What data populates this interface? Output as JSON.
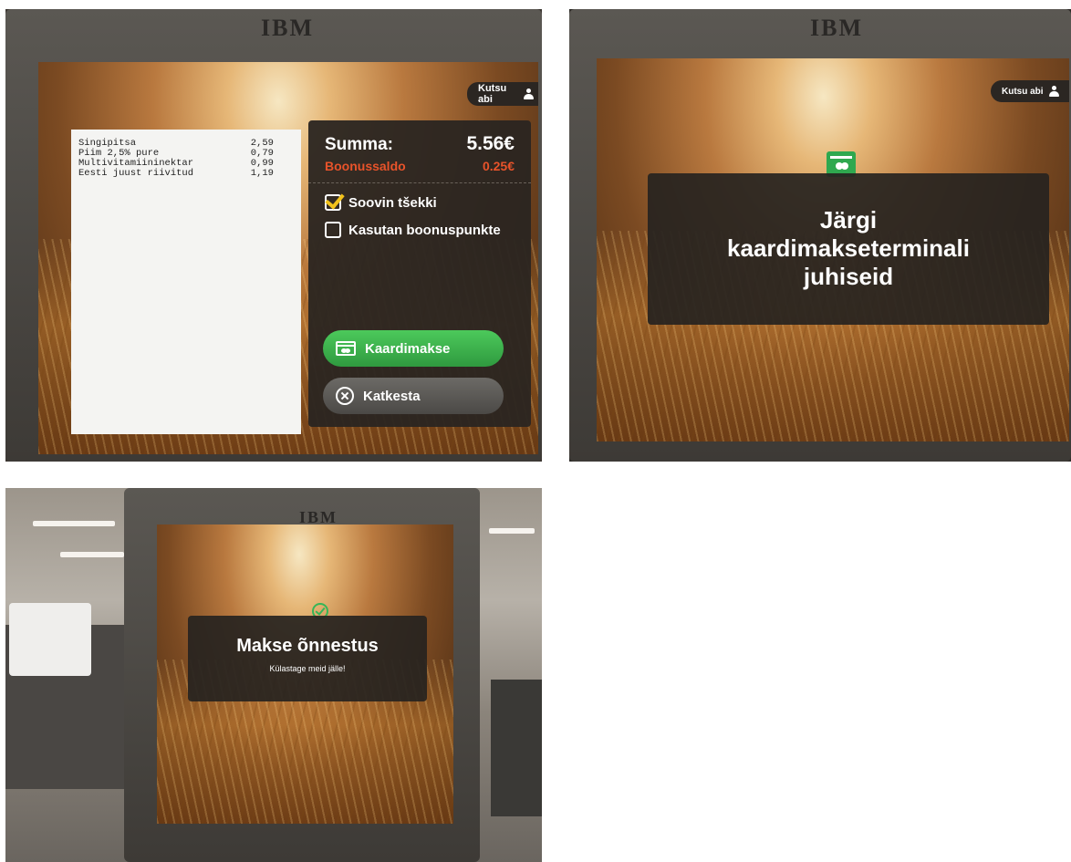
{
  "brand": "IBM",
  "colors": {
    "panel_bg": "#2a2521",
    "accent_orange": "#e8532a",
    "pay_green": "#3ab54a",
    "cancel_grey": "#5b5955",
    "check_yellow": "#f2c21b",
    "success_green": "#36b657"
  },
  "help_button": {
    "label": "Kutsu abi",
    "icon": "person-icon"
  },
  "screen1": {
    "receipt": [
      {
        "name": "Singipitsa",
        "price": "2,59"
      },
      {
        "name": "Piim 2,5% pure",
        "price": "0,79"
      },
      {
        "name": "Multivitamiininektar",
        "price": "0,99"
      },
      {
        "name": "Eesti juust riivitud",
        "price": "1,19"
      }
    ],
    "sum_label": "Summa:",
    "sum_value": "5.56€",
    "bonus_label": "Boonussaldo",
    "bonus_value": "0.25€",
    "options": [
      {
        "label": "Soovin tšekki",
        "checked": true
      },
      {
        "label": "Kasutan boonuspunkte",
        "checked": false
      }
    ],
    "pay_button": {
      "label": "Kaardimakse",
      "icon": "card-icon"
    },
    "cancel_button": {
      "label": "Katkesta",
      "icon": "close-circle-icon"
    }
  },
  "screen2": {
    "icon": "card-terminal-icon",
    "message_lines": [
      "Järgi",
      "kaardimakseterminali",
      "juhiseid"
    ]
  },
  "screen3": {
    "icon": "check-circle-icon",
    "title": "Makse õnnestus",
    "subtitle": "Külastage meid jälle!"
  }
}
